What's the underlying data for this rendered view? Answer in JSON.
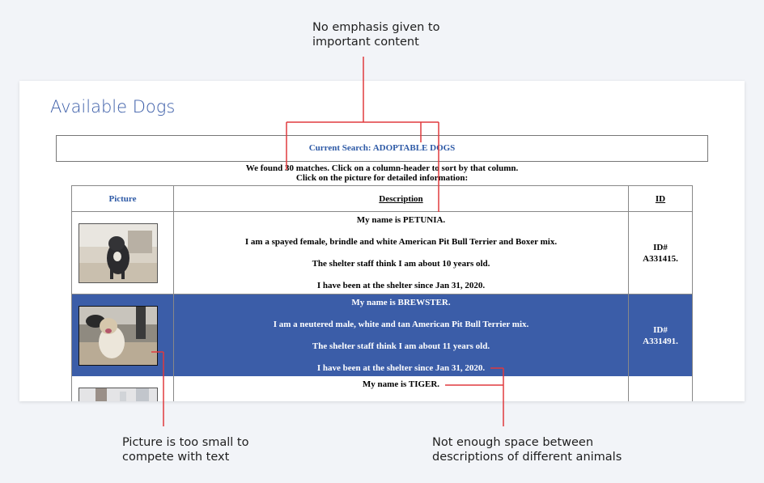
{
  "annotations": {
    "top": [
      "No emphasis given to",
      "important content"
    ],
    "bottom_left": [
      "Picture is too small to",
      "compete with text"
    ],
    "bottom_right": [
      "Not enough space between",
      "descriptions of different animals"
    ]
  },
  "page": {
    "title": "Available Dogs",
    "search_label": "Current Search: ADOPTABLE DOGS",
    "found_text": "We found 30 matches. Click on a column-header to sort by that column.",
    "click_text": "Click on the picture for detailed information:"
  },
  "table": {
    "headers": {
      "picture": "Picture",
      "description": "Description",
      "id": "ID"
    },
    "rows": [
      {
        "name": "My name is PETUNIA.",
        "info": "I am a spayed female, brindle and white American Pit Bull Terrier and Boxer mix.",
        "age": "The shelter staff think I am about 10 years old.",
        "since": "I have been at the shelter since Jan 31, 2020.",
        "id_label": "ID#",
        "id_value": "A331415."
      },
      {
        "name": "My name is BREWSTER.",
        "info": "I am a neutered male, white and tan American Pit Bull Terrier mix.",
        "age": "The shelter staff think I am about 11 years old.",
        "since": "I have been at the shelter since Jan 31, 2020.",
        "id_label": "ID#",
        "id_value": "A331491."
      },
      {
        "name": "My name is TIGER."
      }
    ]
  },
  "colors": {
    "accent": "#3b5da8",
    "annotation_line": "#e03a3e",
    "highlight_row": "#3b5da8"
  }
}
